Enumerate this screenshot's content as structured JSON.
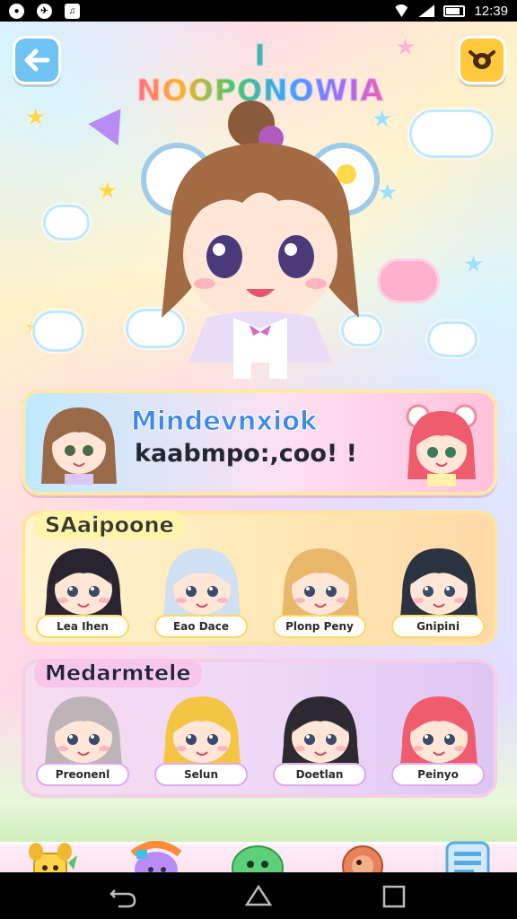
{
  "status_bar": {
    "time": "12:39",
    "icons": [
      "notification-icon",
      "notification-icon",
      "notification-icon",
      "wifi-icon",
      "signal-icon",
      "battery-icon"
    ]
  },
  "header": {
    "title": "I NOOPONOWIA",
    "back_icon": "arrow-left-icon",
    "menu_icon": "mask-icon"
  },
  "banner": {
    "title": "Mindevnxiok",
    "subtitle": "kaabmpo:,coo! !"
  },
  "groups": [
    {
      "title": "SAaipoone",
      "characters": [
        {
          "name": "Lea Ihen",
          "hair": "#2a2430"
        },
        {
          "name": "Eao Dace",
          "hair": "#cfe0f2"
        },
        {
          "name": "Plonp Peny",
          "hair": "#e8b86a"
        },
        {
          "name": "Gnipini",
          "hair": "#2b3340"
        }
      ]
    },
    {
      "title": "Medarmtele",
      "characters": [
        {
          "name": "Preonenl",
          "hair": "#bdb4b8"
        },
        {
          "name": "Selun",
          "hair": "#f3c543"
        },
        {
          "name": "Doetlan",
          "hair": "#2c2a30"
        },
        {
          "name": "Peinyo",
          "hair": "#ee5c6e"
        }
      ]
    }
  ],
  "bottom_nav": [
    {
      "icon": "dog-icon",
      "label": ""
    },
    {
      "icon": "gift-icon",
      "label": ""
    },
    {
      "icon": "slime-icon",
      "label": ""
    },
    {
      "icon": "shell-icon",
      "label": ""
    },
    {
      "icon": "notebook-icon",
      "label": ""
    }
  ],
  "colors": {
    "accent_blue": "#3d8ae8",
    "back_button": "#6ec3f2",
    "menu_button": "#ffc93d",
    "panel_border": "#ffe49a"
  }
}
